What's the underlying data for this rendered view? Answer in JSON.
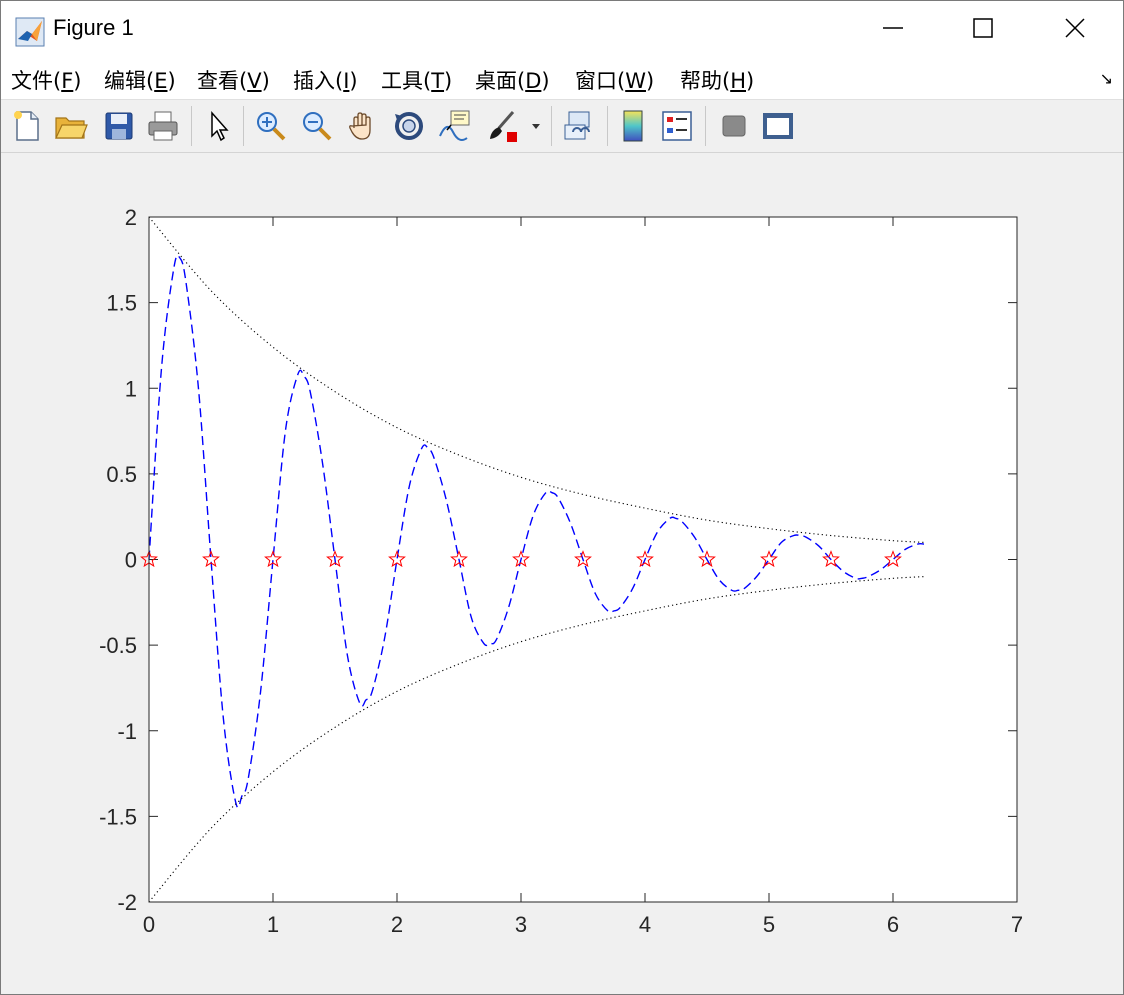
{
  "window": {
    "title": "Figure 1",
    "controls": [
      "minimize",
      "maximize",
      "close"
    ]
  },
  "menu": [
    {
      "label": "文件(F)",
      "key": "F"
    },
    {
      "label": "编辑(E)",
      "key": "E"
    },
    {
      "label": "查看(V)",
      "key": "V"
    },
    {
      "label": "插入(I)",
      "key": "I"
    },
    {
      "label": "工具(T)",
      "key": "T"
    },
    {
      "label": "桌面(D)",
      "key": "D"
    },
    {
      "label": "窗口(W)",
      "key": "W"
    },
    {
      "label": "帮助(H)",
      "key": "H"
    }
  ],
  "menu_arrow": "↘",
  "toolbar": {
    "icons": [
      "new-figure-icon",
      "open-file-icon",
      "save-icon",
      "print-icon",
      "edit-plot-icon",
      "zoom-in-icon",
      "zoom-out-icon",
      "pan-icon",
      "rotate-3d-icon",
      "data-cursor-icon",
      "brush-icon",
      "brush-dropdown-icon",
      "link-plot-icon",
      "insert-colorbar-icon",
      "insert-legend-icon",
      "hide-plot-tools-icon",
      "show-plot-tools-icon"
    ]
  },
  "chart_data": {
    "type": "line",
    "title": "",
    "xlabel": "",
    "ylabel": "",
    "xlim": [
      0,
      7
    ],
    "ylim": [
      -2,
      2
    ],
    "xticks": [
      "0",
      "1",
      "2",
      "3",
      "4",
      "5",
      "6",
      "7"
    ],
    "yticks": [
      "2",
      "1.5",
      "1",
      "0.5",
      "0",
      "-0.5",
      "-1",
      "-1.5",
      "-2"
    ],
    "grid": false,
    "series": [
      {
        "style": "dashed",
        "color": "#0000ff",
        "x": [
          0,
          0.1,
          0.2,
          0.25,
          0.3,
          0.4,
          0.5,
          0.6,
          0.7,
          0.75,
          0.8,
          0.9,
          1.0,
          1.1,
          1.2,
          1.25,
          1.3,
          1.4,
          1.5,
          1.6,
          1.7,
          1.75,
          1.8,
          1.9,
          2.0,
          2.1,
          2.2,
          2.25,
          2.3,
          2.4,
          2.5,
          2.6,
          2.7,
          2.75,
          2.8,
          2.9,
          3.0,
          3.1,
          3.2,
          3.25,
          3.3,
          3.4,
          3.5,
          3.6,
          3.7,
          3.75,
          3.8,
          3.9,
          4.0,
          4.1,
          4.2,
          4.25,
          4.3,
          4.4,
          4.5,
          4.6,
          4.7,
          4.75,
          4.8,
          4.9,
          5.0,
          5.1,
          5.2,
          5.25,
          5.3,
          5.4,
          5.5,
          5.6,
          5.7,
          5.75,
          5.8,
          5.9,
          6.0,
          6.1,
          6.2,
          6.25
        ],
        "y": [
          0,
          1.11,
          1.7,
          1.76,
          1.61,
          0.99,
          0,
          -0.93,
          -1.42,
          -1.38,
          -1.28,
          -0.77,
          0,
          0.75,
          1.08,
          1.07,
          0.98,
          0.56,
          0,
          -0.56,
          -0.84,
          -0.82,
          -0.77,
          -0.46,
          0,
          0.43,
          0.65,
          0.65,
          0.59,
          0.34,
          0,
          -0.34,
          -0.49,
          -0.49,
          -0.47,
          -0.28,
          0,
          0.26,
          0.39,
          0.39,
          0.36,
          0.21,
          0,
          -0.2,
          -0.3,
          -0.3,
          -0.28,
          -0.17,
          0,
          0.16,
          0.24,
          0.24,
          0.22,
          0.13,
          0,
          -0.12,
          -0.18,
          -0.18,
          -0.17,
          -0.1,
          0,
          0.1,
          0.14,
          0.14,
          0.13,
          0.08,
          0,
          -0.07,
          -0.11,
          -0.11,
          -0.1,
          -0.06,
          0,
          0.06,
          0.09,
          0.09
        ]
      },
      {
        "style": "dotted",
        "color": "#000000",
        "x": [
          0,
          0.5,
          1.0,
          1.5,
          2.0,
          2.5,
          3.0,
          3.5,
          4.0,
          4.5,
          5.0,
          5.5,
          6.0,
          6.25
        ],
        "y": [
          2,
          1.57,
          1.24,
          0.98,
          0.77,
          0.61,
          0.48,
          0.38,
          0.3,
          0.23,
          0.18,
          0.14,
          0.11,
          0.1
        ]
      },
      {
        "style": "dotted",
        "color": "#000000",
        "x": [
          0,
          0.5,
          1.0,
          1.5,
          2.0,
          2.5,
          3.0,
          3.5,
          4.0,
          4.5,
          5.0,
          5.5,
          6.0,
          6.25
        ],
        "y": [
          -2,
          -1.57,
          -1.24,
          -0.98,
          -0.77,
          -0.61,
          -0.48,
          -0.38,
          -0.3,
          -0.23,
          -0.18,
          -0.14,
          -0.11,
          -0.1
        ]
      },
      {
        "style": "markers",
        "marker": "pentagram",
        "color": "#ff0000",
        "x": [
          0,
          0.5,
          1.0,
          1.5,
          2.0,
          2.5,
          3.0,
          3.5,
          4.0,
          4.5,
          5.0,
          5.5,
          6.0
        ],
        "y": [
          0,
          0,
          0,
          0,
          0,
          0,
          0,
          0,
          0,
          0,
          0,
          0,
          0
        ]
      }
    ]
  }
}
